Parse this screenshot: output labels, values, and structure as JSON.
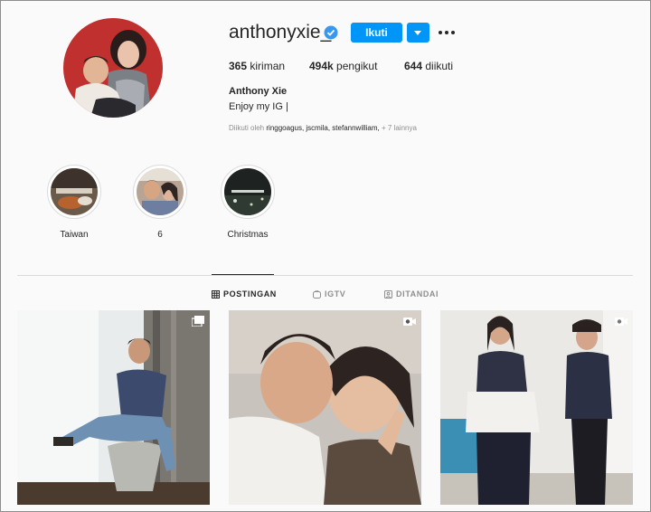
{
  "profile": {
    "username": "anthonyxie_",
    "follow_label": "Ikuti",
    "stats": {
      "posts_count": "365",
      "posts_label": "kiriman",
      "followers_count": "494k",
      "followers_label": "pengikut",
      "following_count": "644",
      "following_label": "diikuti"
    },
    "full_name": "Anthony Xie",
    "bio": "Enjoy my IG |",
    "followed_by_prefix": "Diikuti oleh",
    "followed_by_names": "ringgoagus, jscmila, stefannwilliam,",
    "followed_by_more": "+ 7 lainnya"
  },
  "highlights": [
    {
      "label": "Taiwan"
    },
    {
      "label": "6"
    },
    {
      "label": "Christmas"
    }
  ],
  "tabs": [
    {
      "label": "POSTINGAN",
      "active": true
    },
    {
      "label": "IGTV",
      "active": false
    },
    {
      "label": "DITANDAI",
      "active": false
    }
  ],
  "colors": {
    "accent": "#0095f6",
    "text": "#262626",
    "muted": "#8e8e8e",
    "background": "#fafafa",
    "border": "#dbdbdb"
  },
  "icons": {
    "verified": "verified-badge-icon",
    "more": "more-options-icon",
    "dropdown": "chevron-down-icon",
    "grid": "grid-icon",
    "igtv": "igtv-icon",
    "tagged": "tagged-icon",
    "carousel": "multiple-photos-icon",
    "video": "video-camera-icon"
  }
}
